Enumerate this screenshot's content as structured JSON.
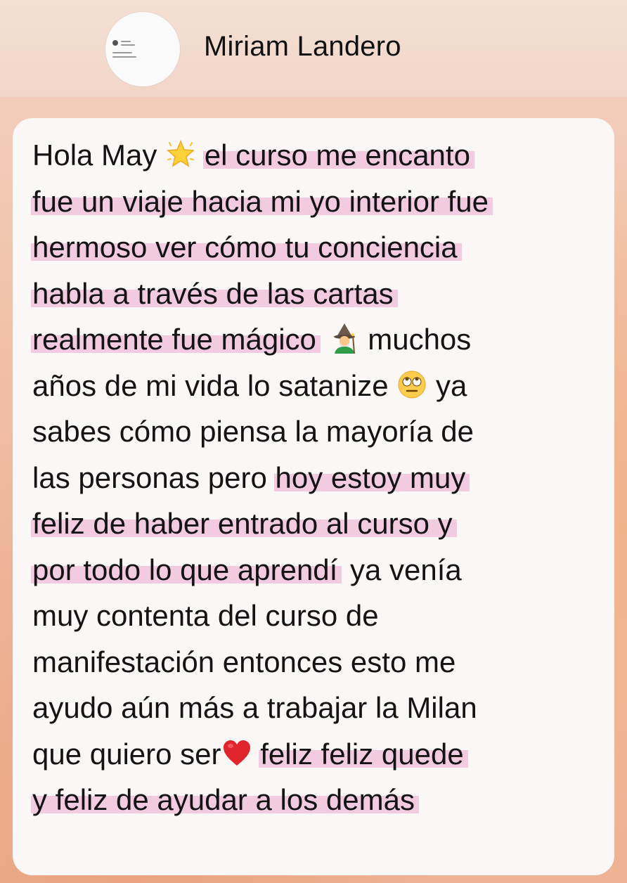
{
  "header": {
    "name": "Miriam Landero"
  },
  "message": {
    "lines": [
      {
        "parts": [
          {
            "t": "Hola May "
          },
          {
            "icon": "glowing-star-emoji"
          },
          {
            "t": " "
          },
          {
            "t": "el curso me encanto",
            "hl": true
          }
        ]
      },
      {
        "parts": [
          {
            "t": "fue un viaje hacia mi yo interior fue",
            "hl": true
          }
        ]
      },
      {
        "parts": [
          {
            "t": "hermoso ver cómo tu conciencia",
            "hl": true
          }
        ]
      },
      {
        "parts": [
          {
            "t": "habla a través de las cartas",
            "hl": true
          }
        ]
      },
      {
        "parts": [
          {
            "t": "realmente fue mágico",
            "hl": true
          },
          {
            "t": " "
          },
          {
            "icon": "mage-emoji"
          },
          {
            "t": " muchos"
          }
        ]
      },
      {
        "parts": [
          {
            "t": "años de mi vida lo satanize "
          },
          {
            "icon": "eye-roll-emoji"
          },
          {
            "t": " ya"
          }
        ]
      },
      {
        "parts": [
          {
            "t": "sabes cómo piensa la mayoría de"
          }
        ]
      },
      {
        "parts": [
          {
            "t": "las personas pero "
          },
          {
            "t": "hoy estoy muy",
            "hl": true
          }
        ]
      },
      {
        "parts": [
          {
            "t": "feliz de haber entrado al curso y",
            "hl": true
          }
        ]
      },
      {
        "parts": [
          {
            "t": "por todo lo que aprendí",
            "hl": true
          },
          {
            "t": " ya venía"
          }
        ]
      },
      {
        "parts": [
          {
            "t": "muy contenta del curso de"
          }
        ]
      },
      {
        "parts": [
          {
            "t": "manifestación entonces esto me"
          }
        ]
      },
      {
        "parts": [
          {
            "t": "ayudo aún más a trabajar la Milan"
          }
        ]
      },
      {
        "parts": [
          {
            "t": "que quiero ser"
          },
          {
            "icon": "red-heart-emoji"
          },
          {
            "t": " "
          },
          {
            "t": "feliz feliz quede",
            "hl": true
          }
        ]
      },
      {
        "parts": [
          {
            "t": "y feliz de ayudar a los demás",
            "hl": true
          }
        ]
      }
    ]
  },
  "colors": {
    "highlight": "#f2cbe0",
    "bubble": "#faf7f6",
    "text": "#141414"
  }
}
